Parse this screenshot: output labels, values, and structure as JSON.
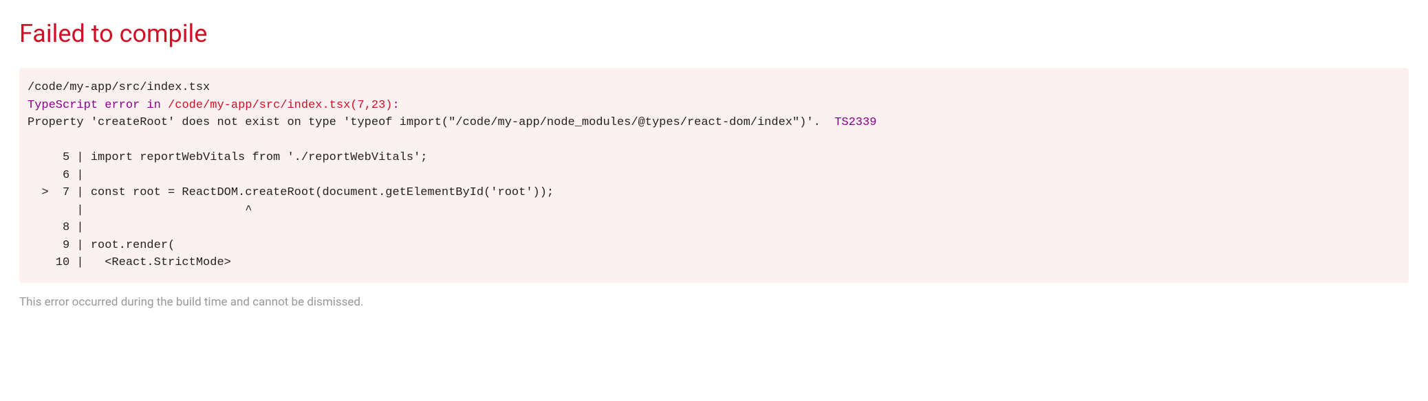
{
  "title": "Failed to compile",
  "filePath": "/code/my-app/src/index.tsx",
  "tsErrorLabel": "TypeScript error",
  "tsErrorIn": " in ",
  "tsErrorFile": "/code/my-app/src/index.tsx(7,23)",
  "tsErrorColon": ":",
  "errorMessage": "Property 'createRoot' does not exist on type 'typeof import(\"/code/my-app/node_modules/@types/react-dom/index\")'.  ",
  "errorCode": "TS2339",
  "codeLines": "\n     5 | import reportWebVitals from './reportWebVitals';\n     6 | \n  >  7 | const root = ReactDOM.createRoot(document.getElementById('root'));\n       |                       ^\n     8 | \n     9 | root.render(\n    10 |   <React.StrictMode>",
  "footerNote": "This error occurred during the build time and cannot be dismissed."
}
